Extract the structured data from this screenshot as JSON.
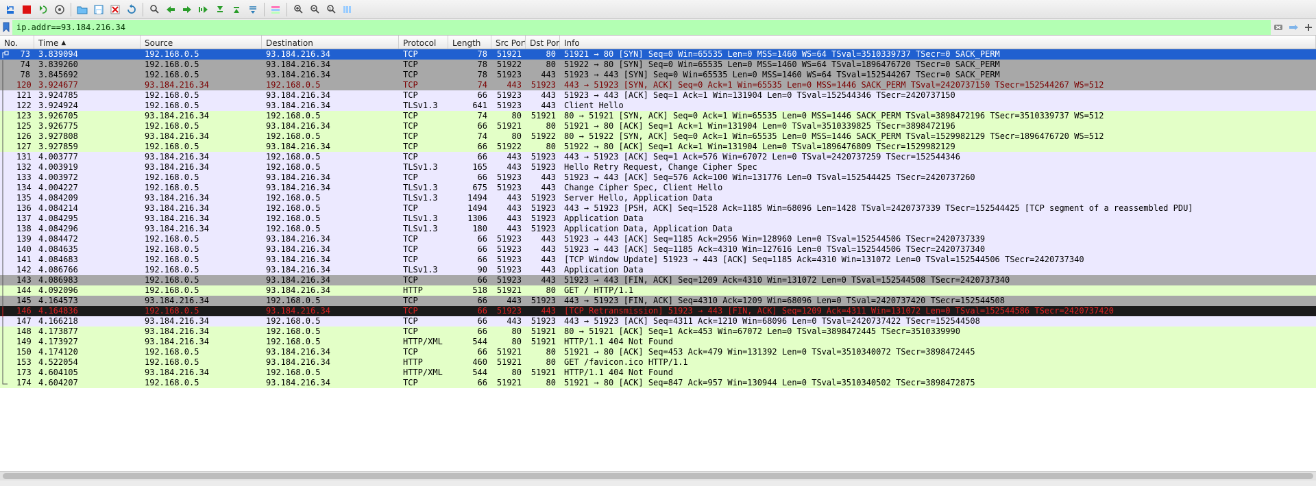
{
  "filter": {
    "value": "ip.addr==93.184.216.34"
  },
  "columns": {
    "no": "No.",
    "time": "Time",
    "source": "Source",
    "destination": "Destination",
    "protocol": "Protocol",
    "length": "Length",
    "srcport": "Src Port",
    "dstport": "Dst Port",
    "info": "Info"
  },
  "packets": [
    {
      "no": 73,
      "time": "3.839094",
      "src": "192.168.0.5",
      "dst": "93.184.216.34",
      "proto": "TCP",
      "len": 78,
      "sport": "51921",
      "dport": "80",
      "info": "51921 → 80 [SYN] Seq=0 Win=65535 Len=0 MSS=1460 WS=64 TSval=3510339737 TSecr=0 SACK_PERM",
      "cls": "selected",
      "mk": "first"
    },
    {
      "no": 74,
      "time": "3.839260",
      "src": "192.168.0.5",
      "dst": "93.184.216.34",
      "proto": "TCP",
      "len": 78,
      "sport": "51922",
      "dport": "80",
      "info": "51922 → 80 [SYN] Seq=0 Win=65535 Len=0 MSS=1460 WS=64 TSval=1896476720 TSecr=0 SACK_PERM",
      "cls": "syn",
      "mk": "mid"
    },
    {
      "no": 78,
      "time": "3.845692",
      "src": "192.168.0.5",
      "dst": "93.184.216.34",
      "proto": "TCP",
      "len": 78,
      "sport": "51923",
      "dport": "443",
      "info": "51923 → 443 [SYN] Seq=0 Win=65535 Len=0 MSS=1460 WS=64 TSval=152544267 TSecr=0 SACK_PERM",
      "cls": "syn",
      "mk": "mid"
    },
    {
      "no": 120,
      "time": "3.924677",
      "src": "93.184.216.34",
      "dst": "192.168.0.5",
      "proto": "TCP",
      "len": 74,
      "sport": "443",
      "dport": "51923",
      "info": "443 → 51923 [SYN, ACK] Seq=0 Ack=1 Win=65535 Len=0 MSS=1446 SACK_PERM TSval=2420737150 TSecr=152544267 WS=512",
      "cls": "syn2",
      "mk": "mid"
    },
    {
      "no": 121,
      "time": "3.924785",
      "src": "192.168.0.5",
      "dst": "93.184.216.34",
      "proto": "TCP",
      "len": 66,
      "sport": "51923",
      "dport": "443",
      "info": "51923 → 443 [ACK] Seq=1 Ack=1 Win=131904 Len=0 TSval=152544346 TSecr=2420737150",
      "cls": "tls-lav",
      "mk": "mid"
    },
    {
      "no": 122,
      "time": "3.924924",
      "src": "192.168.0.5",
      "dst": "93.184.216.34",
      "proto": "TLSv1.3",
      "len": 641,
      "sport": "51923",
      "dport": "443",
      "info": "Client Hello",
      "cls": "tls-lav",
      "mk": "mid"
    },
    {
      "no": 123,
      "time": "3.926705",
      "src": "93.184.216.34",
      "dst": "192.168.0.5",
      "proto": "TCP",
      "len": 74,
      "sport": "80",
      "dport": "51921",
      "info": "80 → 51921 [SYN, ACK] Seq=0 Ack=1 Win=65535 Len=0 MSS=1446 SACK_PERM TSval=3898472196 TSecr=3510339737 WS=512",
      "cls": "http-row",
      "mk": "mid"
    },
    {
      "no": 125,
      "time": "3.926775",
      "src": "192.168.0.5",
      "dst": "93.184.216.34",
      "proto": "TCP",
      "len": 66,
      "sport": "51921",
      "dport": "80",
      "info": "51921 → 80 [ACK] Seq=1 Ack=1 Win=131904 Len=0 TSval=3510339825 TSecr=3898472196",
      "cls": "http-row",
      "mk": "mid"
    },
    {
      "no": 126,
      "time": "3.927808",
      "src": "93.184.216.34",
      "dst": "192.168.0.5",
      "proto": "TCP",
      "len": 74,
      "sport": "80",
      "dport": "51922",
      "info": "80 → 51922 [SYN, ACK] Seq=0 Ack=1 Win=65535 Len=0 MSS=1446 SACK_PERM TSval=1529982129 TSecr=1896476720 WS=512",
      "cls": "http-row",
      "mk": "mid"
    },
    {
      "no": 127,
      "time": "3.927859",
      "src": "192.168.0.5",
      "dst": "93.184.216.34",
      "proto": "TCP",
      "len": 66,
      "sport": "51922",
      "dport": "80",
      "info": "51922 → 80 [ACK] Seq=1 Ack=1 Win=131904 Len=0 TSval=1896476809 TSecr=1529982129",
      "cls": "http-row",
      "mk": "mid"
    },
    {
      "no": 131,
      "time": "4.003777",
      "src": "93.184.216.34",
      "dst": "192.168.0.5",
      "proto": "TCP",
      "len": 66,
      "sport": "443",
      "dport": "51923",
      "info": "443 → 51923 [ACK] Seq=1 Ack=576 Win=67072 Len=0 TSval=2420737259 TSecr=152544346",
      "cls": "tls-lav",
      "mk": "mid"
    },
    {
      "no": 132,
      "time": "4.003919",
      "src": "93.184.216.34",
      "dst": "192.168.0.5",
      "proto": "TLSv1.3",
      "len": 165,
      "sport": "443",
      "dport": "51923",
      "info": "Hello Retry Request, Change Cipher Spec",
      "cls": "tls-lav",
      "mk": "mid"
    },
    {
      "no": 133,
      "time": "4.003972",
      "src": "192.168.0.5",
      "dst": "93.184.216.34",
      "proto": "TCP",
      "len": 66,
      "sport": "51923",
      "dport": "443",
      "info": "51923 → 443 [ACK] Seq=576 Ack=100 Win=131776 Len=0 TSval=152544425 TSecr=2420737260",
      "cls": "tls-lav",
      "mk": "mid"
    },
    {
      "no": 134,
      "time": "4.004227",
      "src": "192.168.0.5",
      "dst": "93.184.216.34",
      "proto": "TLSv1.3",
      "len": 675,
      "sport": "51923",
      "dport": "443",
      "info": "Change Cipher Spec, Client Hello",
      "cls": "tls-lav",
      "mk": "mid"
    },
    {
      "no": 135,
      "time": "4.084209",
      "src": "93.184.216.34",
      "dst": "192.168.0.5",
      "proto": "TLSv1.3",
      "len": 1494,
      "sport": "443",
      "dport": "51923",
      "info": "Server Hello, Application Data",
      "cls": "tls-lav",
      "mk": "mid"
    },
    {
      "no": 136,
      "time": "4.084214",
      "src": "93.184.216.34",
      "dst": "192.168.0.5",
      "proto": "TCP",
      "len": 1494,
      "sport": "443",
      "dport": "51923",
      "info": "443 → 51923 [PSH, ACK] Seq=1528 Ack=1185 Win=68096 Len=1428 TSval=2420737339 TSecr=152544425 [TCP segment of a reassembled PDU]",
      "cls": "tls-lav",
      "mk": "mid"
    },
    {
      "no": 137,
      "time": "4.084295",
      "src": "93.184.216.34",
      "dst": "192.168.0.5",
      "proto": "TLSv1.3",
      "len": 1306,
      "sport": "443",
      "dport": "51923",
      "info": "Application Data",
      "cls": "tls-lav",
      "mk": "mid"
    },
    {
      "no": 138,
      "time": "4.084296",
      "src": "93.184.216.34",
      "dst": "192.168.0.5",
      "proto": "TLSv1.3",
      "len": 180,
      "sport": "443",
      "dport": "51923",
      "info": "Application Data, Application Data",
      "cls": "tls-lav",
      "mk": "mid"
    },
    {
      "no": 139,
      "time": "4.084472",
      "src": "192.168.0.5",
      "dst": "93.184.216.34",
      "proto": "TCP",
      "len": 66,
      "sport": "51923",
      "dport": "443",
      "info": "51923 → 443 [ACK] Seq=1185 Ack=2956 Win=128960 Len=0 TSval=152544506 TSecr=2420737339",
      "cls": "tls-lav",
      "mk": "mid"
    },
    {
      "no": 140,
      "time": "4.084635",
      "src": "192.168.0.5",
      "dst": "93.184.216.34",
      "proto": "TCP",
      "len": 66,
      "sport": "51923",
      "dport": "443",
      "info": "51923 → 443 [ACK] Seq=1185 Ack=4310 Win=127616 Len=0 TSval=152544506 TSecr=2420737340",
      "cls": "tls-lav",
      "mk": "mid"
    },
    {
      "no": 141,
      "time": "4.084683",
      "src": "192.168.0.5",
      "dst": "93.184.216.34",
      "proto": "TCP",
      "len": 66,
      "sport": "51923",
      "dport": "443",
      "info": "[TCP Window Update] 51923 → 443 [ACK] Seq=1185 Ack=4310 Win=131072 Len=0 TSval=152544506 TSecr=2420737340",
      "cls": "tls-lav",
      "mk": "mid"
    },
    {
      "no": 142,
      "time": "4.086766",
      "src": "192.168.0.5",
      "dst": "93.184.216.34",
      "proto": "TLSv1.3",
      "len": 90,
      "sport": "51923",
      "dport": "443",
      "info": "Application Data",
      "cls": "tls-lav",
      "mk": "mid"
    },
    {
      "no": 143,
      "time": "4.086983",
      "src": "192.168.0.5",
      "dst": "93.184.216.34",
      "proto": "TCP",
      "len": 66,
      "sport": "51923",
      "dport": "443",
      "info": "51923 → 443 [FIN, ACK] Seq=1209 Ack=4310 Win=131072 Len=0 TSval=152544508 TSecr=2420737340",
      "cls": "fin-row",
      "mk": "mid"
    },
    {
      "no": 144,
      "time": "4.092096",
      "src": "192.168.0.5",
      "dst": "93.184.216.34",
      "proto": "HTTP",
      "len": 518,
      "sport": "51921",
      "dport": "80",
      "info": "GET / HTTP/1.1",
      "cls": "http-row",
      "mk": "mid"
    },
    {
      "no": 145,
      "time": "4.164573",
      "src": "93.184.216.34",
      "dst": "192.168.0.5",
      "proto": "TCP",
      "len": 66,
      "sport": "443",
      "dport": "51923",
      "info": "443 → 51923 [FIN, ACK] Seq=4310 Ack=1209 Win=68096 Len=0 TSval=2420737420 TSecr=152544508",
      "cls": "fin-row",
      "mk": "mid"
    },
    {
      "no": 146,
      "time": "4.164836",
      "src": "192.168.0.5",
      "dst": "93.184.216.34",
      "proto": "TCP",
      "len": 66,
      "sport": "51923",
      "dport": "443",
      "info": "[TCP Retransmission] 51923 → 443 [FIN, ACK] Seq=1209 Ack=4311 Win=131072 Len=0 TSval=152544586 TSecr=2420737420",
      "cls": "retx",
      "mk": "mid"
    },
    {
      "no": 147,
      "time": "4.166218",
      "src": "93.184.216.34",
      "dst": "192.168.0.5",
      "proto": "TCP",
      "len": 66,
      "sport": "443",
      "dport": "51923",
      "info": "443 → 51923 [ACK] Seq=4311 Ack=1210 Win=68096 Len=0 TSval=2420737422 TSecr=152544508",
      "cls": "tls-lav",
      "mk": "mid"
    },
    {
      "no": 148,
      "time": "4.173877",
      "src": "93.184.216.34",
      "dst": "192.168.0.5",
      "proto": "TCP",
      "len": 66,
      "sport": "80",
      "dport": "51921",
      "info": "80 → 51921 [ACK] Seq=1 Ack=453 Win=67072 Len=0 TSval=3898472445 TSecr=3510339990",
      "cls": "http-row",
      "mk": "mid"
    },
    {
      "no": 149,
      "time": "4.173927",
      "src": "93.184.216.34",
      "dst": "192.168.0.5",
      "proto": "HTTP/XML",
      "len": 544,
      "sport": "80",
      "dport": "51921",
      "info": "HTTP/1.1 404 Not Found",
      "cls": "http-row",
      "mk": "mid"
    },
    {
      "no": 150,
      "time": "4.174120",
      "src": "192.168.0.5",
      "dst": "93.184.216.34",
      "proto": "TCP",
      "len": 66,
      "sport": "51921",
      "dport": "80",
      "info": "51921 → 80 [ACK] Seq=453 Ack=479 Win=131392 Len=0 TSval=3510340072 TSecr=3898472445",
      "cls": "http-row",
      "mk": "mid"
    },
    {
      "no": 153,
      "time": "4.522054",
      "src": "192.168.0.5",
      "dst": "93.184.216.34",
      "proto": "HTTP",
      "len": 460,
      "sport": "51921",
      "dport": "80",
      "info": "GET /favicon.ico HTTP/1.1",
      "cls": "http-row",
      "mk": "mid"
    },
    {
      "no": 173,
      "time": "4.604105",
      "src": "93.184.216.34",
      "dst": "192.168.0.5",
      "proto": "HTTP/XML",
      "len": 544,
      "sport": "80",
      "dport": "51921",
      "info": "HTTP/1.1 404 Not Found",
      "cls": "http-row",
      "mk": "mid"
    },
    {
      "no": 174,
      "time": "4.604207",
      "src": "192.168.0.5",
      "dst": "93.184.216.34",
      "proto": "TCP",
      "len": 66,
      "sport": "51921",
      "dport": "80",
      "info": "51921 → 80 [ACK] Seq=847 Ack=957 Win=130944 Len=0 TSval=3510340502 TSecr=3898472875",
      "cls": "http-row",
      "mk": "last"
    }
  ]
}
